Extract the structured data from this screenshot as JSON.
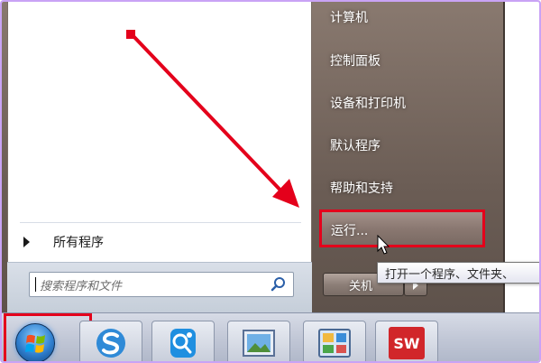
{
  "start_menu": {
    "all_programs_label": "所有程序",
    "search_placeholder": "搜索程序和文件",
    "right_items": [
      "计算机",
      "控制面板",
      "设备和打印机",
      "默认程序",
      "帮助和支持"
    ],
    "run_label": "运行...",
    "shutdown_label": "关机"
  },
  "tooltip": {
    "text": "打开一个程序、文件夹、"
  },
  "taskbar": {
    "pinned_icons": [
      "sogou-s-icon",
      "qq-icon",
      "picture-viewer-icon",
      "control-panel-icon",
      "solidworks-icon"
    ],
    "sw_label": "SW"
  },
  "colors": {
    "annotation_red": "#e4001b"
  }
}
